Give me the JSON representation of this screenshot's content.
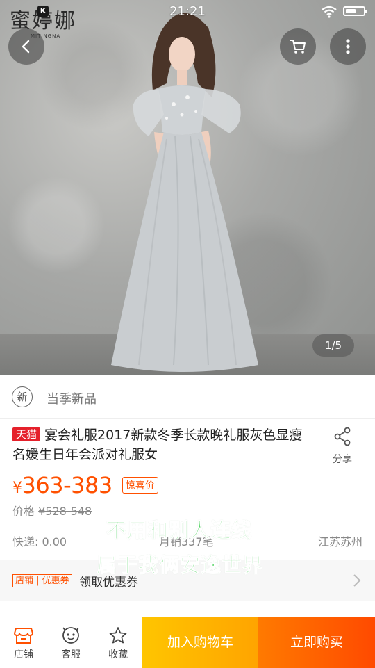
{
  "status_bar": {
    "time": "21:21",
    "badge": "K"
  },
  "hero": {
    "brand_cn": "蜜婷娜",
    "brand_en": "MITINGNA",
    "image_counter": "1/5"
  },
  "new_row": {
    "icon_char": "新",
    "label": "当季新品"
  },
  "product": {
    "tag": "天猫",
    "title": "宴会礼服2017新款冬季长款晚礼服灰色显瘦名媛生日年会派对礼服女",
    "share_label": "分享",
    "currency": "¥",
    "price": "363-383",
    "deal_badge": "惊喜价",
    "orig_label": "价格",
    "orig_price": "¥528-548",
    "shipping": "快递: 0.00",
    "monthly_sales": "月销337笔",
    "location": "江苏苏州"
  },
  "overlay": {
    "line1": "不用和别人连线",
    "line2": "属于我俩安逸世界"
  },
  "coupon": {
    "tag": "店铺 | 优惠券",
    "label": "领取优惠券"
  },
  "bottom_bar": {
    "shop_label": "店铺",
    "service_label": "客服",
    "favorite_label": "收藏",
    "add_cart": "加入购物车",
    "buy_now": "立即购买"
  },
  "colors": {
    "accent": "#ff5000",
    "tmall_red": "#e5212b",
    "cart_yellow": "#ffa400",
    "buy_orange": "#ff5a00"
  }
}
